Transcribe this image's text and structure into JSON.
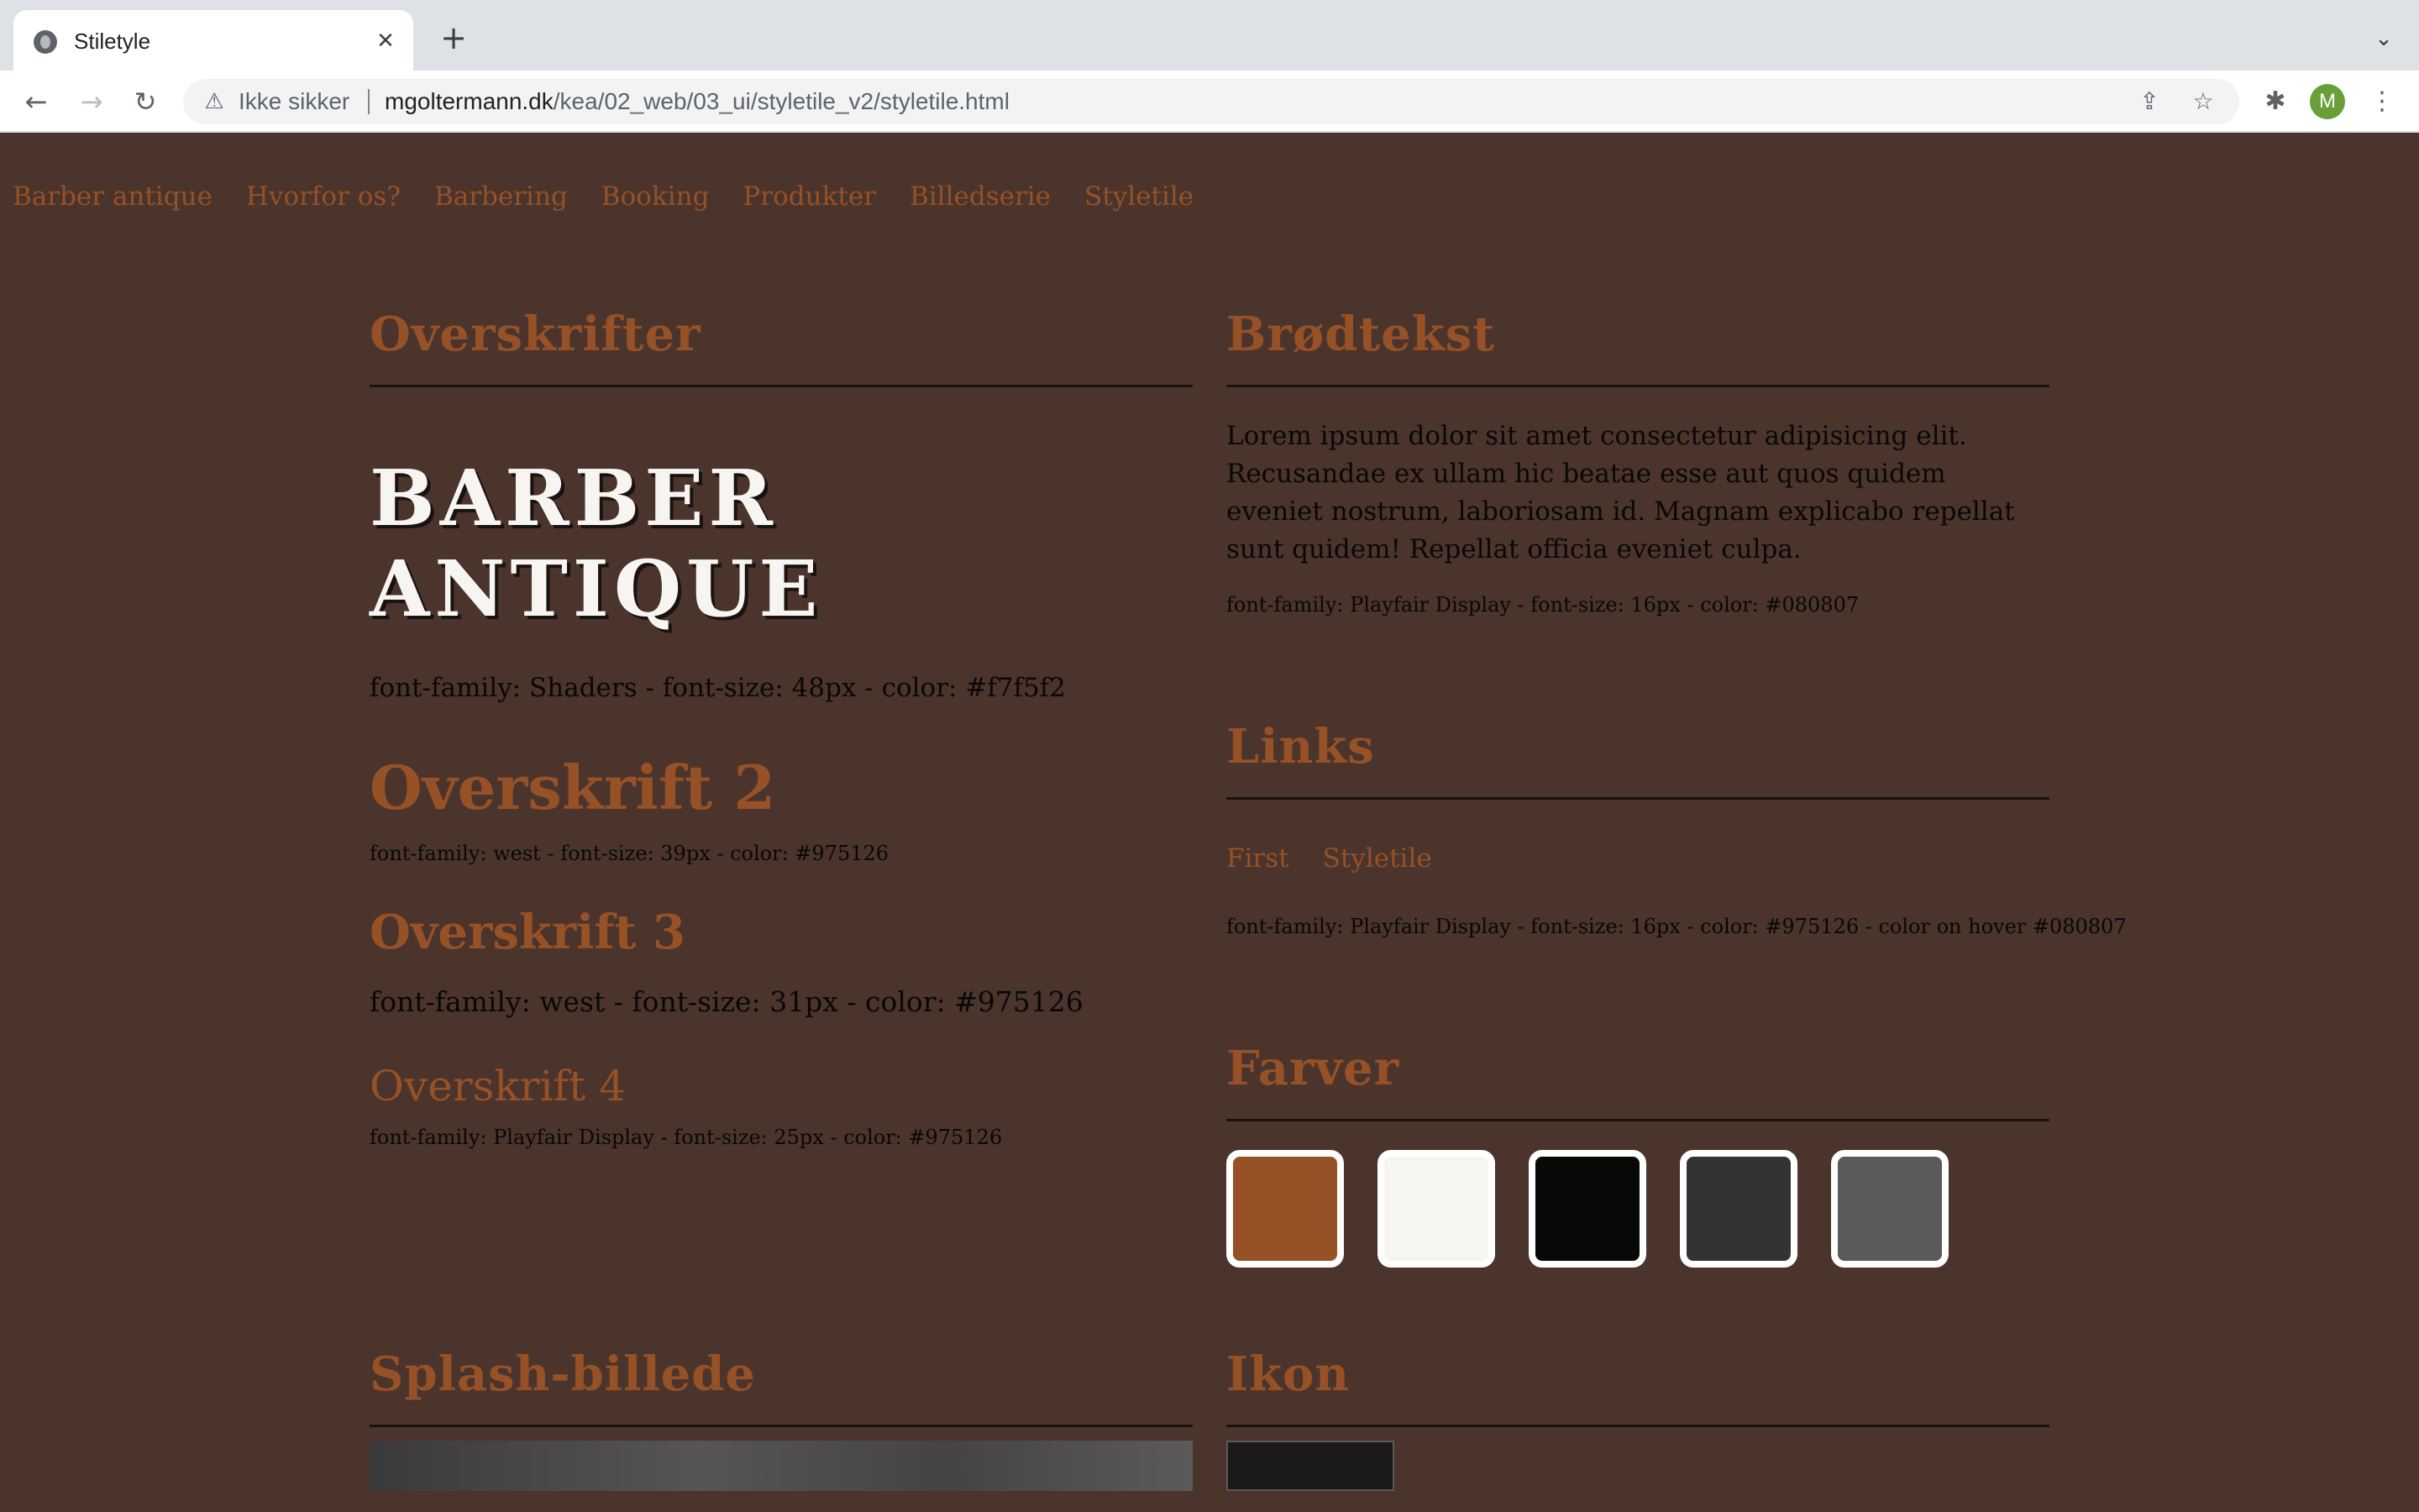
{
  "browser": {
    "tab_title": "Stiletyle",
    "tab_close": "✕",
    "new_tab": "+",
    "tab_list": "⌄",
    "back": "←",
    "forward": "→",
    "reload": "↻",
    "security_label": "Ikke sikker",
    "url_host": "mgoltermann.dk",
    "url_path": "/kea/02_web/03_ui/styletile_v2/styletile.html",
    "avatar_letter": "M"
  },
  "site_nav": [
    "Barber antique",
    "Hvorfor os?",
    "Barbering",
    "Booking",
    "Produkter",
    "Billedserie",
    "Styletile"
  ],
  "headings_section": {
    "title": "Overskrifter",
    "display_line1": "BARBER",
    "display_line2": "ANTIQUE",
    "display_spec": "font-family: Shaders - font-size: 48px - color: #f7f5f2",
    "h2": "Overskrift 2",
    "h2_spec": "font-family: west - font-size: 39px - color: #975126",
    "h3": "Overskrift 3",
    "h3_spec": "font-family: west - font-size: 31px - color: #975126",
    "h4": "Overskrift 4",
    "h4_spec": "font-family: Playfair Display - font-size: 25px - color: #975126"
  },
  "body_section": {
    "title": "Brødtekst",
    "paragraph": "Lorem ipsum dolor sit amet consectetur adipisicing elit. Recusandae ex ullam hic beatae esse aut quos quidem eveniet nostrum, laboriosam id. Magnam explicabo repellat sunt quidem! Repellat officia eveniet culpa.",
    "spec": "font-family: Playfair Display - font-size: 16px - color: #080807"
  },
  "links_section": {
    "title": "Links",
    "links": [
      "First",
      "Styletile"
    ],
    "spec": "font-family: Playfair Display - font-size: 16px - color: #975126 - color on hover #080807"
  },
  "colors_section": {
    "title": "Farver",
    "swatches": [
      "#975126",
      "#f7f5f2",
      "#080807",
      "#333333",
      "#5a5a5a"
    ]
  },
  "splash_section": {
    "title": "Splash-billede"
  },
  "icon_section": {
    "title": "Ikon"
  }
}
